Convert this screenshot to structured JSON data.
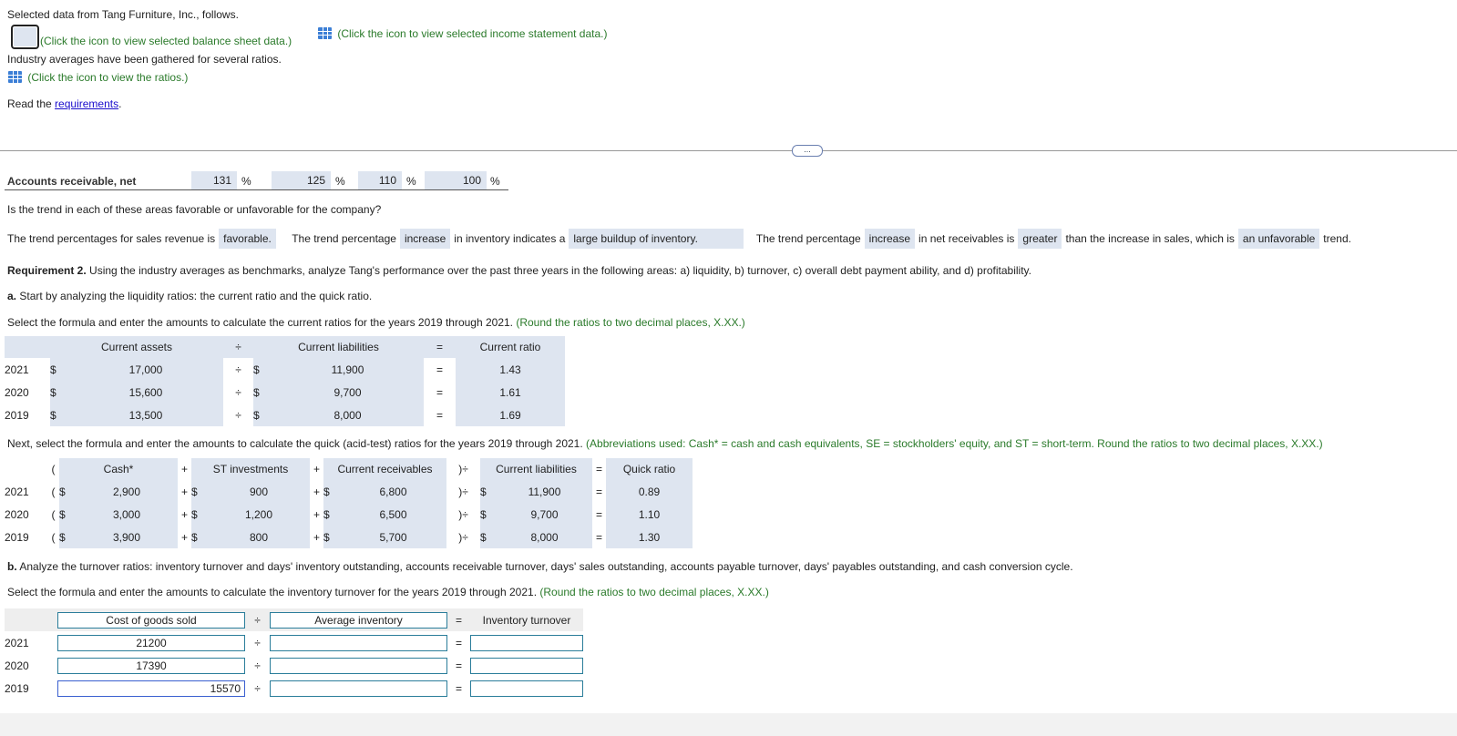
{
  "intro": {
    "line1": "Selected data from Tang Furniture, Inc., follows.",
    "balance_link": "(Click the icon to view selected balance sheet data.)",
    "income_link": "(Click the icon to view selected income statement data.)",
    "industry": "Industry averages have been gathered for several ratios.",
    "ratios_link": "(Click the icon to view the ratios.)",
    "read_prefix": "Read the ",
    "read_link": "requirements",
    "read_suffix": "."
  },
  "divider_label": "...",
  "ar_row": {
    "label": "Accounts receivable, net",
    "values": [
      "131",
      "125",
      "110",
      "100"
    ],
    "unit": "%"
  },
  "question": "Is the trend in each of these areas favorable or unfavorable for the company?",
  "trend": {
    "t1": "The trend percentages for sales revenue is",
    "s1": "favorable.",
    "t2": "The trend percentage",
    "s2": "increase",
    "t3": "in inventory indicates a",
    "s3": "large buildup of inventory.",
    "t4": "The trend percentage",
    "s4": "increase",
    "t5": "in net receivables is",
    "s5": "greater",
    "t6": "than the increase in sales, which is",
    "s6": "an unfavorable",
    "t7": "trend."
  },
  "req2": {
    "bold": "Requirement 2.",
    "text": " Using the industry averages as benchmarks, analyze Tang's performance over the past three years in the following areas: a) liquidity, b) turnover, c) overall debt payment ability, and d) profitability."
  },
  "part_a": {
    "bold": "a.",
    "text": " Start by analyzing the liquidity ratios: the current ratio and the quick ratio."
  },
  "current": {
    "instr": "Select the formula and enter the amounts to calculate the current ratios for the years 2019 through 2021.",
    "note": "(Round the ratios to two decimal places, X.XX.)",
    "headers": [
      "Current assets",
      "÷",
      "Current liabilities",
      "=",
      "Current ratio"
    ],
    "rows": [
      {
        "year": "2021",
        "ca": "17,000",
        "cl": "11,900",
        "ratio": "1.43"
      },
      {
        "year": "2020",
        "ca": "15,600",
        "cl": "9,700",
        "ratio": "1.61"
      },
      {
        "year": "2019",
        "ca": "13,500",
        "cl": "8,000",
        "ratio": "1.69"
      }
    ]
  },
  "quick": {
    "instr": "Next, select the formula and enter the amounts to calculate the quick (acid-test) ratios for the years 2019 through 2021.",
    "note": "(Abbreviations used: Cash* = cash and cash equivalents, SE = stockholders' equity, and ST = short-term. Round the ratios to two decimal places, X.XX.)",
    "headers": [
      "(",
      "Cash*",
      "+",
      "ST investments",
      "+",
      "Current receivables",
      ")÷",
      "Current liabilities",
      "=",
      "Quick ratio"
    ],
    "rows": [
      {
        "year": "2021",
        "cash": "2,900",
        "st": "900",
        "cr": "6,800",
        "cl": "11,900",
        "ratio": "0.89"
      },
      {
        "year": "2020",
        "cash": "3,000",
        "st": "1,200",
        "cr": "6,500",
        "cl": "9,700",
        "ratio": "1.10"
      },
      {
        "year": "2019",
        "cash": "3,900",
        "st": "800",
        "cr": "5,700",
        "cl": "8,000",
        "ratio": "1.30"
      }
    ]
  },
  "part_b": {
    "bold": "b.",
    "text": " Analyze the turnover ratios: inventory turnover and days' inventory outstanding, accounts receivable turnover, days' sales outstanding, accounts payable turnover, days' payables outstanding, and cash conversion cycle."
  },
  "inventory": {
    "instr": "Select the formula and enter the amounts to calculate the inventory turnover for the years 2019 through 2021.",
    "note": "(Round the ratios to two decimal places, X.XX.)",
    "headers": [
      "Cost of goods sold",
      "÷",
      "Average inventory",
      "=",
      "Inventory turnover"
    ],
    "rows": [
      {
        "year": "2021",
        "cogs": "21200",
        "avg": "",
        "turn": ""
      },
      {
        "year": "2020",
        "cogs": "17390",
        "avg": "",
        "turn": ""
      },
      {
        "year": "2019",
        "cogs": "15570",
        "avg": "",
        "turn": ""
      }
    ]
  },
  "sym": {
    "dollar": "$",
    "div": "÷",
    "eq": "=",
    "plus": "+",
    "lp": "(",
    "rpdiv": ")÷"
  }
}
